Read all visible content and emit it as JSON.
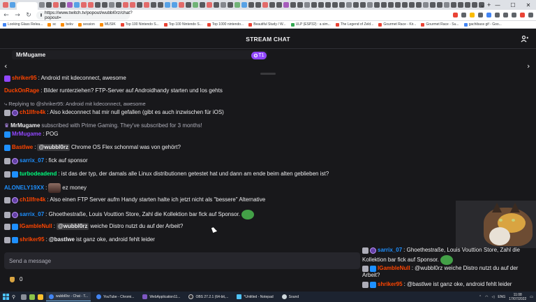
{
  "browser": {
    "url": "https://www.twitch.tv/popout/wubbl0rz/chat?popout=",
    "bookmarks": [
      "Looking Glass Relea...",
      "sc",
      "bekv",
      "session",
      "MUSIK",
      "Top 100 Nintendo S...",
      "Top 100 Nintendo S...",
      "Top 1000 nintendo...",
      "Beautiful Study / W...",
      "ULP (ESP32) : a sim...",
      "The Legend of Zeld...",
      "Gourmet Race - Kir...",
      "Gourmet Race - Su...",
      "gachibass gif - Goo..."
    ]
  },
  "header": {
    "title": "STREAM CHAT"
  },
  "pinned": {
    "name": "MrMugame",
    "badge": "T1"
  },
  "colors": {
    "bg": "#18181b",
    "accent": "#9147ff",
    "input_bg": "#26262c"
  },
  "messages": [
    {
      "user": "shriker95",
      "text": ": Android mit kdeconnect, awesome",
      "color": "#ff4500"
    },
    {
      "user": "DuckOnRage",
      "text": ": Bilder runterziehen? FTP-Server auf Androidhandy starten und los gehts",
      "color": "#ff4500"
    },
    {
      "reply": "Replying to @shriker95: Android mit kdeconnect, awesome"
    },
    {
      "user": "ch1llfre4k",
      "text": ": Also kdeconnect hat mir null gefallen (gibt es auch inzwischen für iOS)",
      "color": "#ff4500"
    },
    {
      "user": "MrMugame",
      "text": "subscribed with Prime Gaming. They've subscribed for 3 months!"
    },
    {
      "user": "MrMugame",
      "text": ": POG",
      "color": "#9147ff"
    },
    {
      "user": "Bastlwe",
      "mention": "@wubbl0rz",
      "text": "Chrome OS Flex schonmal was von gehört?",
      "color": "#ff4500"
    },
    {
      "user": "sarrix_07",
      "text": ": fick auf sponsor",
      "color": "#1e90ff"
    },
    {
      "user": "turbodeadend",
      "text": ": ist das der typ, der damals alle Linux distributionen getestet hat und dann am ende beim alten geblieben ist?",
      "color": "#00ff7f"
    },
    {
      "user": "ALONELY19XX",
      "text": "ez money",
      "color": "#1e90ff"
    },
    {
      "user": "ch1llfre4k",
      "text": ": Also einen FTP Server aufm Handy starten halte ich jetzt nicht als \"bessere\" Alternative",
      "color": "#ff4500"
    },
    {
      "user": "sarrix_07",
      "text": ": Ghoethestraße, Louis Vouttion Store, Zahl die Kollektion bar fick auf Sponsor.",
      "color": "#1e90ff"
    },
    {
      "user": "IGambleNull",
      "mention": "@wubbl0rz",
      "text": "weiche Distro nutzt du auf der Arbeit?",
      "color": "#ff4500"
    },
    {
      "user": "shriker95",
      "mention": "@bastlwe",
      "text": "ist ganz oke, android fehlt leider",
      "color": "#ff4500"
    }
  ],
  "input": {
    "placeholder": "Send a message"
  },
  "points": {
    "value": "0"
  },
  "overlay": {
    "line1_user": "sarrix_07",
    "line1_text": ": Ghoethestraße, Louis Vouttion Store, Zahl die",
    "line1b": "Kollektion bar fick auf Sponsor.",
    "line2_user": "IGambleNull",
    "line2_text": ": @wubbl0rz weiche Distro nutzt du auf der",
    "line2b": "Arbeit?",
    "line3_user": "shriker95",
    "line3_text": ": @bastlwe ist ganz oke, android fehlt leider"
  },
  "taskbar": {
    "apps": [
      "wubbl0rz - Chat - T...",
      "YouTube - Chromi...",
      "WebApplication11...",
      "OBS 27.2.1 (64-bit,...",
      "*Untitled - Notepad",
      "Sound"
    ],
    "lang": "ENG",
    "time": "11:08",
    "date": "17/07/2022"
  }
}
